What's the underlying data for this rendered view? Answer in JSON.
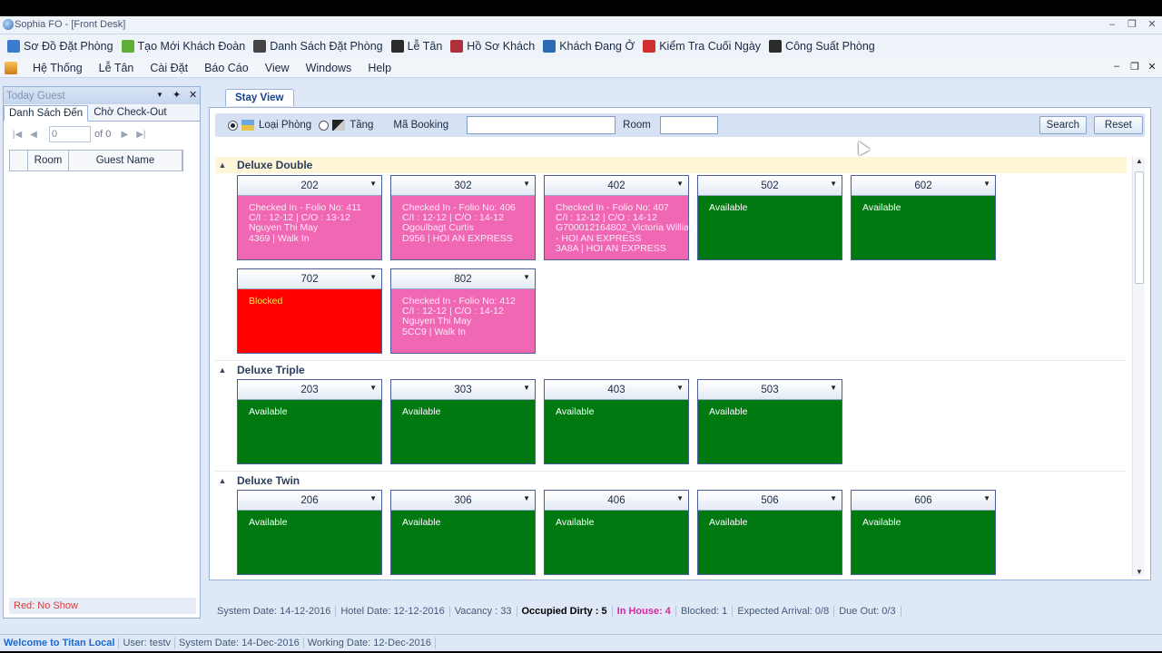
{
  "window": {
    "title": "Sophia FO - [Front Desk]"
  },
  "toolbar": {
    "items": [
      {
        "label": "Sơ Đồ Đặt Phòng",
        "icon": "room-map-icon",
        "color": "#3b7bd0"
      },
      {
        "label": "Tạo Mới Khách Đoàn",
        "icon": "group-add-icon",
        "color": "#5fae3a"
      },
      {
        "label": "Danh Sách Đặt Phòng",
        "icon": "list-icon",
        "color": "#444444"
      },
      {
        "label": "Lễ Tân",
        "icon": "reception-icon",
        "color": "#2b2b2b"
      },
      {
        "label": "Hồ Sơ Khách",
        "icon": "guest-profile-icon",
        "color": "#b0303a"
      },
      {
        "label": "Khách Đang Ở",
        "icon": "in-house-icon",
        "color": "#2d6ab4"
      },
      {
        "label": "Kiểm Tra Cuối Ngày",
        "icon": "night-audit-icon",
        "color": "#d23030"
      },
      {
        "label": "Công Suất Phòng",
        "icon": "bar-chart-icon",
        "color": "#2b2b2b"
      }
    ]
  },
  "menu": {
    "items": [
      "Hệ Thống",
      "Lễ Tân",
      "Cài Đặt",
      "Báo Cáo",
      "View",
      "Windows",
      "Help"
    ]
  },
  "left_panel": {
    "title": "Today Guest",
    "tabs": [
      "Danh Sách Đến",
      "Chờ Check-Out"
    ],
    "pager": {
      "value": "0",
      "of": "of 0"
    },
    "columns": [
      "Room",
      "Guest Name"
    ],
    "footer": "Red: No Show"
  },
  "doc_tab": "Stay View",
  "filter": {
    "radio1": "Loại Phòng",
    "radio2": "Tầng",
    "booking_label": "Mã Booking",
    "room_label": "Room",
    "search": "Search",
    "reset": "Reset"
  },
  "colors": {
    "available": "#007a10",
    "checked_in": "#f067b4",
    "blocked": "#ff0000"
  },
  "groups": [
    {
      "name": "Deluxe Double",
      "rooms": [
        {
          "no": "202",
          "status": "checked",
          "text": "Checked In - Folio No: 411\nC/I : 12-12 | C/O : 13-12\nNguyen Thi May\n4369 | Walk In"
        },
        {
          "no": "302",
          "status": "checked",
          "text": "Checked In - Folio No: 406\nC/I : 12-12 | C/O : 14-12\nOgoulbagt Curtis\nD956 | HOI AN EXPRESS"
        },
        {
          "no": "402",
          "status": "checked",
          "text": "Checked In - Folio No: 407\nC/I : 12-12 | C/O : 14-12\nG700012164802_Victoria Willia\n- HOI AN EXPRESS\n3A8A | HOI AN EXPRESS"
        },
        {
          "no": "502",
          "status": "avail",
          "text": "Available"
        },
        {
          "no": "602",
          "status": "avail",
          "text": "Available"
        },
        {
          "no": "702",
          "status": "blocked",
          "text": "Blocked"
        },
        {
          "no": "802",
          "status": "checked",
          "text": "Checked In - Folio No: 412\nC/I : 12-12 | C/O : 14-12\nNguyen Thi May\n5CC9 | Walk In"
        }
      ]
    },
    {
      "name": "Deluxe Triple",
      "rooms": [
        {
          "no": "203",
          "status": "avail",
          "text": "Available"
        },
        {
          "no": "303",
          "status": "avail",
          "text": "Available"
        },
        {
          "no": "403",
          "status": "avail",
          "text": "Available"
        },
        {
          "no": "503",
          "status": "avail",
          "text": "Available"
        }
      ]
    },
    {
      "name": "Deluxe Twin",
      "rooms": [
        {
          "no": "206",
          "status": "avail",
          "text": "Available"
        },
        {
          "no": "306",
          "status": "avail",
          "text": "Available"
        },
        {
          "no": "406",
          "status": "avail",
          "text": "Available"
        },
        {
          "no": "506",
          "status": "avail",
          "text": "Available"
        },
        {
          "no": "606",
          "status": "avail",
          "text": "Available"
        }
      ]
    }
  ],
  "status": {
    "system_date": "System Date: 14-12-2016",
    "hotel_date": "Hotel Date: 12-12-2016",
    "vacancy": "Vacancy : 33",
    "occupied_dirty": "Occupied Dirty : 5",
    "in_house": "In House: 4",
    "blocked": "Blocked: 1",
    "expected_arrival": "Expected Arrival: 0/8",
    "due_out": "Due Out: 0/3"
  },
  "footer": {
    "welcome": "Welcome to Titan Local",
    "user": "User: testv",
    "system_date": "System Date: 14-Dec-2016",
    "working_date": "Working Date: 12-Dec-2016"
  }
}
